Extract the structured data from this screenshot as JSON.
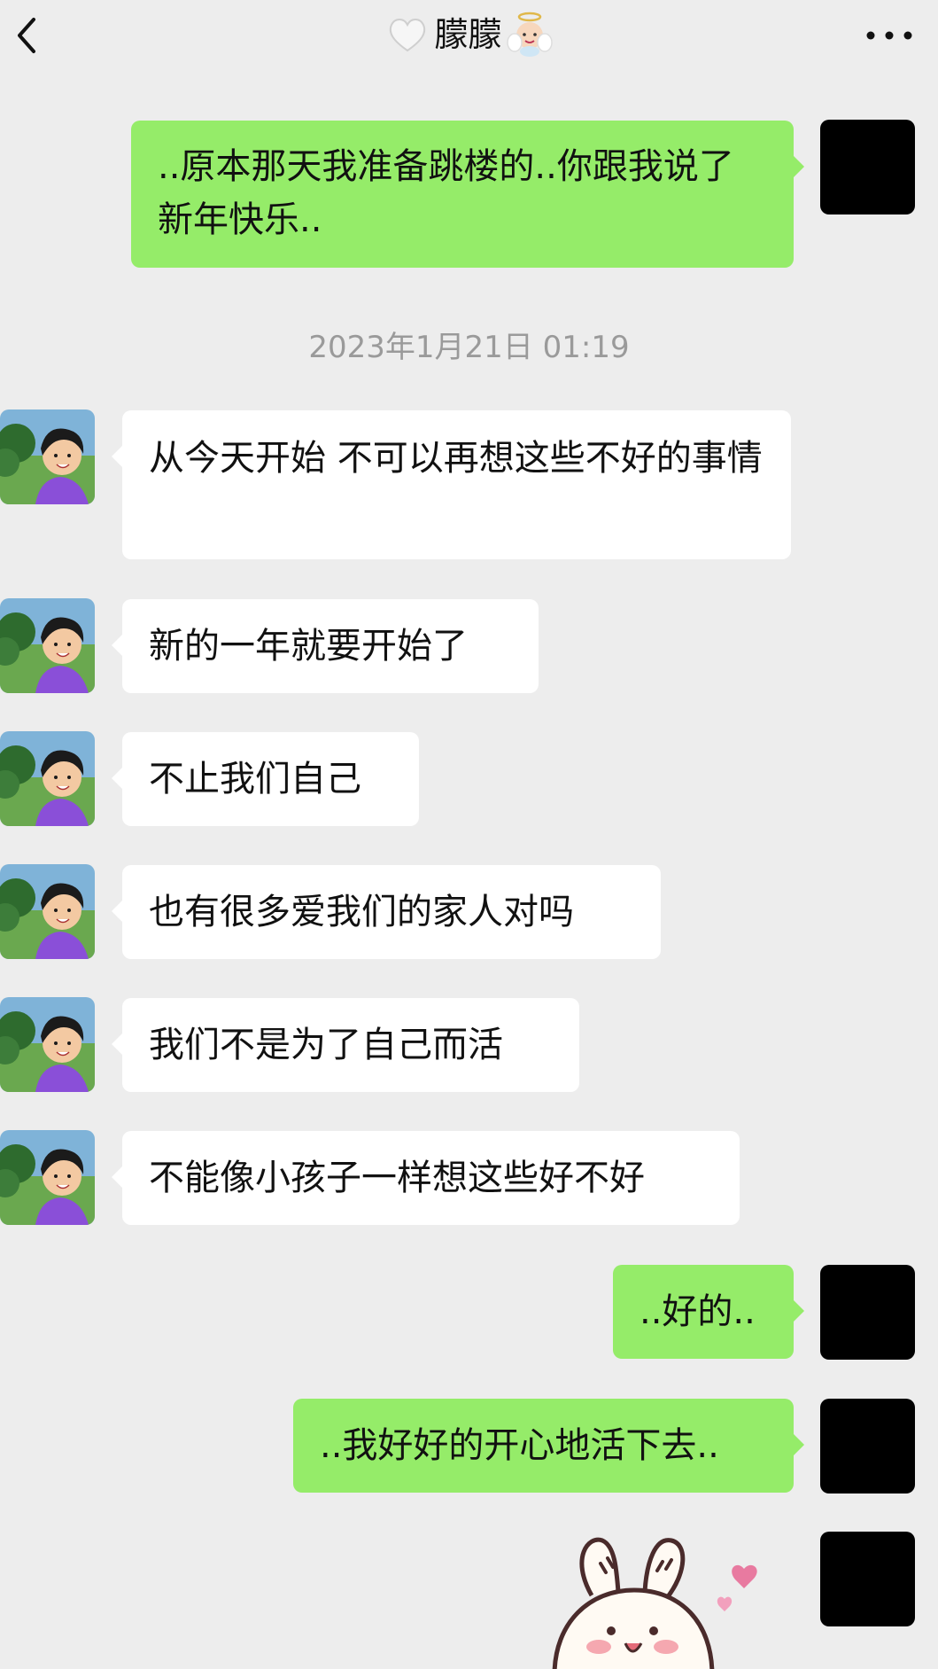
{
  "header": {
    "title": "朦朦",
    "back_icon": "chevron-left-icon",
    "more_icon": "more-dots-icon",
    "title_prefix_icon": "white-heart-icon",
    "title_suffix_icon": "baby-angel-icon"
  },
  "timestamp": "2023年1月21日 01:19",
  "messages": [
    {
      "side": "right",
      "text": "..原本那天我准备跳楼的..你跟我说了新年快乐.."
    },
    {
      "side": "left",
      "text": "从今天开始 不可以再想这些不好的事情"
    },
    {
      "side": "left",
      "text": "新的一年就要开始了"
    },
    {
      "side": "left",
      "text": "不止我们自己"
    },
    {
      "side": "left",
      "text": "也有很多爱我们的家人对吗"
    },
    {
      "side": "left",
      "text": "我们不是为了自己而活"
    },
    {
      "side": "left",
      "text": "不能像小孩子一样想这些好不好"
    },
    {
      "side": "right",
      "text": "..好的.."
    },
    {
      "side": "right",
      "text": "..我好好的开心地活下去.."
    },
    {
      "side": "right",
      "sticker": "bunny-heart-sticker"
    }
  ],
  "colors": {
    "background": "#ededed",
    "bubble_self": "#95ec69",
    "bubble_other": "#ffffff",
    "timestamp": "#9a9a9a"
  }
}
